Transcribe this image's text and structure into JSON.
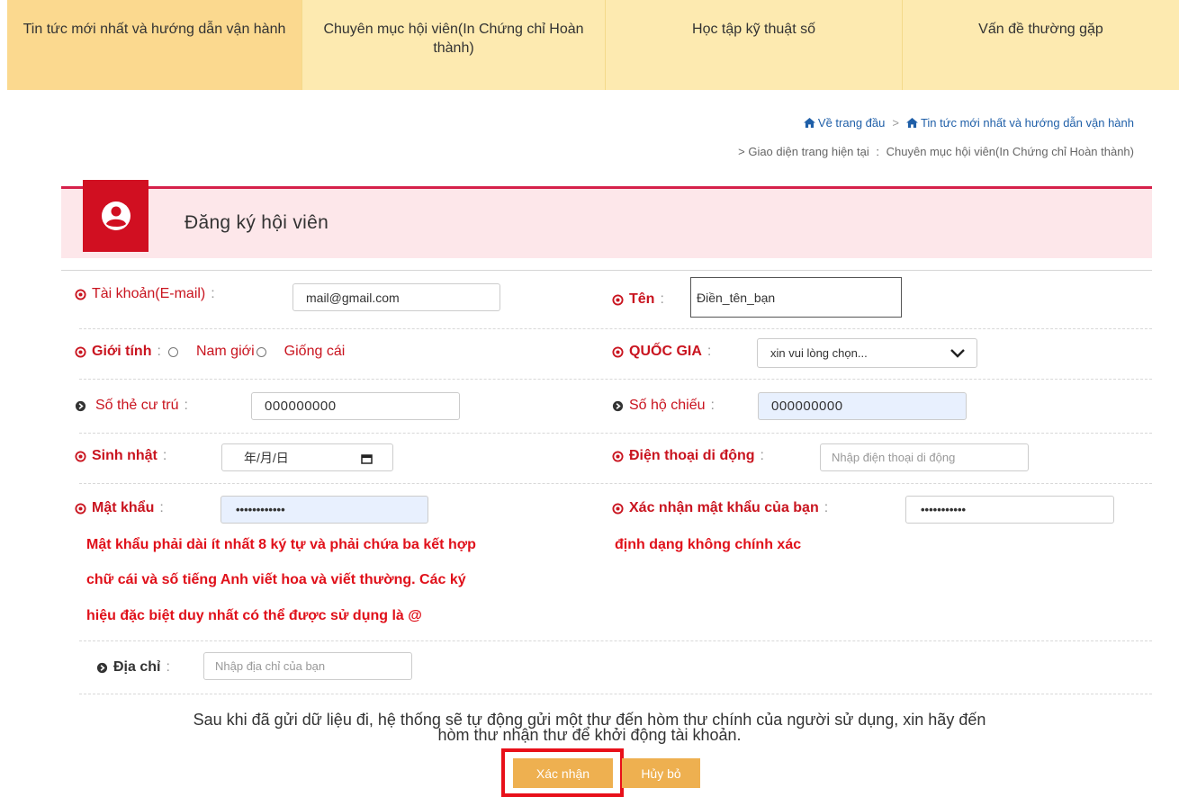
{
  "nav": {
    "tabs": [
      {
        "label": "Tin tức mới nhất và hướng dẫn vận hành"
      },
      {
        "label": "Chuyên mục hội viên(In Chứng chỉ Hoàn thành)"
      },
      {
        "label": "Học tập kỹ thuật số"
      },
      {
        "label": "Vấn đề thường gặp"
      }
    ]
  },
  "breadcrumb": {
    "home": "Về trang đầu",
    "sep": ">",
    "news": "Tin tức mới nhất và hướng dẫn vận hành",
    "current_prefix": "> Giao diện trang hiện tại",
    "current_colon": ":",
    "current": "Chuyên mục hội viên(In Chứng chỉ Hoàn thành)"
  },
  "panel": {
    "title": "Đăng ký hội viên",
    "badge_icon": "user-circle-icon"
  },
  "colon": ":",
  "form": {
    "account": {
      "label": "Tài khoản(E-mail)",
      "value": "mail@gmail.com"
    },
    "name": {
      "label": "Tên",
      "value": "Điền_tên_bạn"
    },
    "gender": {
      "label": "Giới tính",
      "options": [
        "Nam giới",
        "Giống cái"
      ]
    },
    "country": {
      "label": "QUỐC GIA",
      "value": "xin vui lòng chọn..."
    },
    "residence": {
      "label": "Số thẻ cư trú",
      "value": "000000000"
    },
    "passport": {
      "label": "Số hộ chiếu",
      "value": "000000000"
    },
    "birthday": {
      "label": "Sinh nhật",
      "value": "年/月/日"
    },
    "phone": {
      "label": "Điện thoại di động",
      "placeholder": "Nhập điện thoại di động"
    },
    "password": {
      "label": "Mật khẩu",
      "value": "••••••••••••"
    },
    "confirm_password": {
      "label": "Xác nhận mật khẩu của bạn",
      "value": "•••••••••••"
    },
    "password_error": [
      "Mật khẩu phải dài ít nhất 8 ký tự và phải chứa ba kết hợp",
      "chữ cái và số tiếng Anh viết hoa và viết thường. Các ký",
      "hiệu đặc biệt duy nhất có thể được sử dụng là @"
    ],
    "confirm_error": "định dạng không chính xác",
    "address": {
      "label": "Địa chỉ",
      "placeholder": "Nhập địa chỉ của bạn"
    }
  },
  "notice": [
    "Sau khi đã gửi dữ liệu đi, hệ thống sẽ tự động gửi một thư đến hòm thư chính của người sử dụng, xin hãy đến",
    "hòm thư nhận thư để khởi động tài khoản."
  ],
  "buttons": {
    "confirm": "Xác nhận",
    "cancel": "Hủy bỏ"
  },
  "colors": {
    "accent_red": "#c9141f",
    "nav_bg": "#fdeab0",
    "button": "#eeb050",
    "panel_bg": "#fde7ea"
  }
}
